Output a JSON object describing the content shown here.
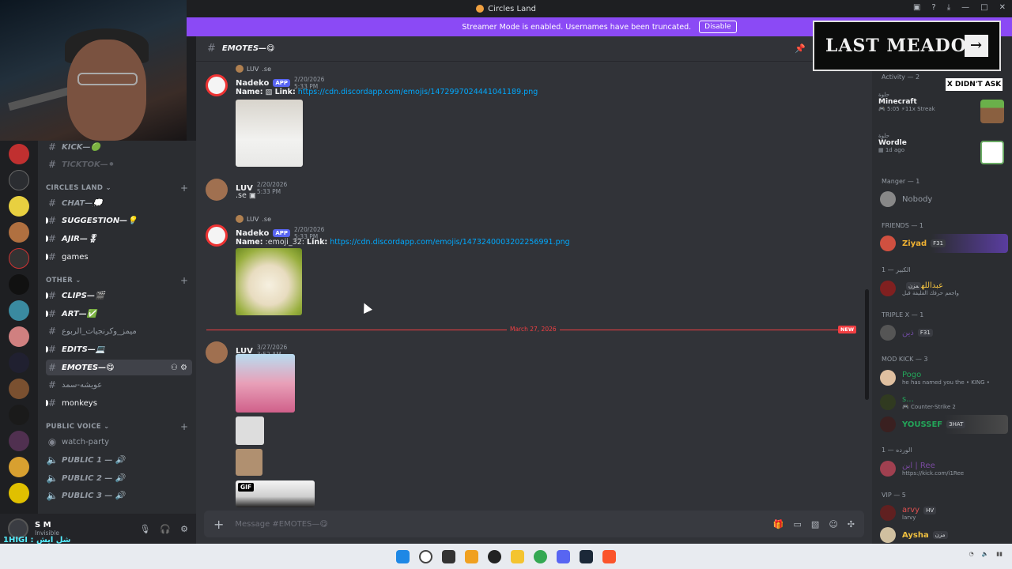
{
  "window": {
    "title": "Circles Land"
  },
  "streamer_bar": {
    "text": "Streamer Mode is enabled. Usernames have been truncated.",
    "button": "Disable"
  },
  "overlay": {
    "banner": "LAST MEADOW",
    "banner_arrow": "→",
    "tag": "X DIDN'T ASK"
  },
  "channels": {
    "top": [
      {
        "name": "KICK—🟢",
        "style": "italic"
      },
      {
        "name": "TICKTOK—⚫",
        "style": "italic"
      }
    ],
    "category1": "CIRCLES LAND",
    "cat1_items": [
      {
        "name": "CHAT—💭"
      },
      {
        "name": "SUGGESTION—💡"
      },
      {
        "name": "AJIR—🎖"
      },
      {
        "name": "games"
      }
    ],
    "category2": "OTHER",
    "cat2_items": [
      {
        "name": "CLIPS—🎬"
      },
      {
        "name": "ART—✅"
      },
      {
        "name": "ميمز_وكرنجيات_الربوع"
      },
      {
        "name": "EDITS—💻"
      },
      {
        "name": "EMOTES—😋"
      },
      {
        "name": "عويشه-سمد"
      },
      {
        "name": "monkeys"
      }
    ],
    "category3": "PUBLIC VOICE",
    "voice_items": [
      {
        "name": "watch-party"
      },
      {
        "name": "PUBLIC 1 — 🔊"
      },
      {
        "name": "PUBLIC 2 — 🔊"
      },
      {
        "name": "PUBLIC 3 — 🔊"
      }
    ],
    "plus": "+"
  },
  "user": {
    "name": "S M",
    "status": "Invisible"
  },
  "bottom_strip": "1HIGI : شل ايش",
  "header": {
    "channel": "EMOTES—😋"
  },
  "messages": [
    {
      "reply_name": "LUV",
      "reply_text": ".se",
      "author": "Nadeko",
      "badge": "APP",
      "time": "2/20/2026 5:33 PM",
      "label_name": "Name:",
      "label_link": "Link:",
      "link": "https://cdn.discordapp.com/emojis/1472997024441041189.png"
    },
    {
      "author": "LUV",
      "time": "2/20/2026 5:33 PM",
      "text": ".se"
    },
    {
      "reply_name": "LUV",
      "reply_text": ".se",
      "author": "Nadeko",
      "badge": "APP",
      "time": "2/20/2026 5:33 PM",
      "label_name": "Name:",
      "emoji": ":emoji_32:",
      "label_link": "Link:",
      "link": "https://cdn.discordapp.com/emojis/1473240003202256991.png"
    },
    {
      "author": "LUV",
      "time": "3/27/2026 3:52 AM",
      "gif_label": "GIF"
    }
  ],
  "divider": {
    "date": "March 27, 2026",
    "new": "NEW"
  },
  "composer": {
    "placeholder": "Message #EMOTES—😋"
  },
  "members": {
    "activity_header": "Activity — 2",
    "activities": [
      {
        "user": "حلوة",
        "game": "Minecraft",
        "detail": "5:05",
        "streak": "11x Streak"
      },
      {
        "user": "حلوة",
        "game": "Wordle",
        "detail": "1d ago"
      }
    ],
    "manager_header": "Manger — 1",
    "manager": "Nobody",
    "friends_header": "FRIENDS — 1",
    "friend": {
      "name": "Ziyad",
      "tag": "F31"
    },
    "big_header": "الكبير — 1",
    "big_member": {
      "name": "عبدالله",
      "sub": "واجعم حرفك القليفة قبل",
      "tag": "مزن"
    },
    "triple_header": "TRIPLE X — 1",
    "triple_member": {
      "name": "ذين",
      "tag": "F31"
    },
    "mod_header": "MOD KICK — 3",
    "mods": [
      {
        "name": "Pogo",
        "sub": "he has named you the • KING •"
      },
      {
        "name": "s...",
        "sub": "Counter-Strike 2"
      },
      {
        "name": "YOUSSEF",
        "tag": "3HAT"
      }
    ],
    "rose_header": "الورده — 1",
    "rose_member": {
      "name": "ابن | Ree",
      "sub": "https://kick.com/i1Ree"
    },
    "vip_header": "VIP — 5",
    "vips": [
      {
        "name": "arvy",
        "tag": "HV",
        "sub": "larvy"
      },
      {
        "name": "Aysha",
        "tag": "مزن"
      }
    ]
  },
  "colors": {
    "accent": "#5865f2",
    "streamer": "#8b4af5",
    "link": "#00a8fc",
    "new": "#f23f43"
  }
}
